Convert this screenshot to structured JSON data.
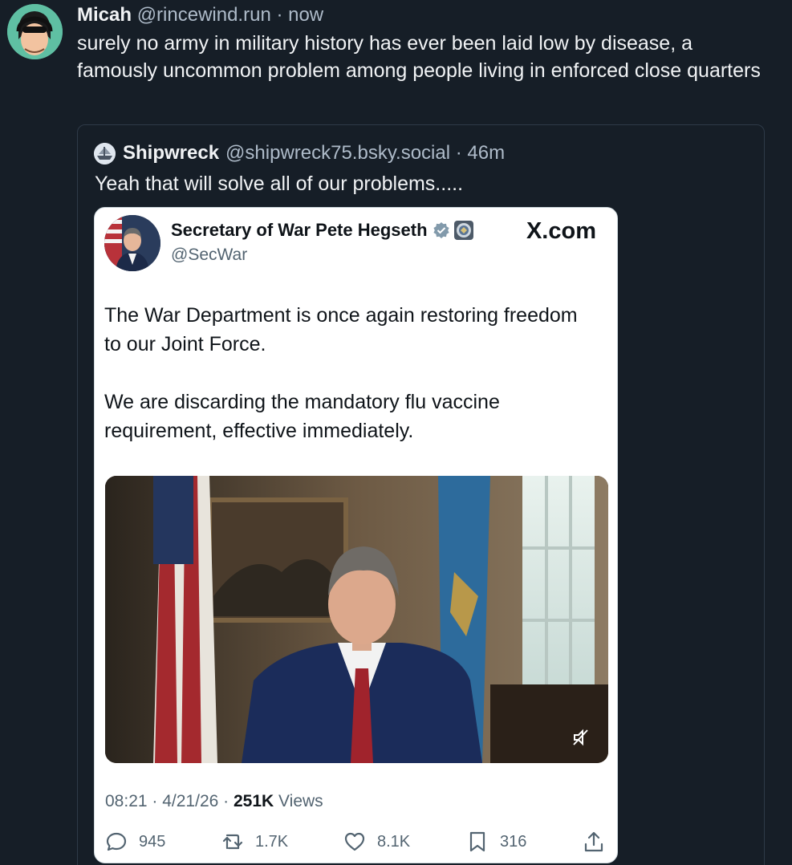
{
  "post": {
    "author_name": "Micah",
    "author_meta": "@rincewind.run · now",
    "text": "surely no army in military history has ever been laid low by disease, a famously uncommon problem among people living in enforced close quarters"
  },
  "quote": {
    "author_name": "Shipwreck",
    "author_meta": "@shipwreck75.bsky.social · 46m",
    "text": "Yeah that will solve all of our problems....."
  },
  "embed": {
    "author_name": "Secretary of War Pete Hegseth",
    "handle": "@SecWar",
    "brand": "X.com",
    "body": [
      "The War Department is once again restoring freedom to our Joint Force.",
      "We are discarding the mandatory flu vaccine requirement, effective immediately."
    ],
    "time": "08:21",
    "date": "4/21/26",
    "views_count": "251K",
    "views_label": "Views",
    "replies": "945",
    "reposts": "1.7K",
    "likes": "8.1K",
    "bookmarks": "316"
  },
  "colors": {
    "background": "#161e27",
    "muted_text": "#aebbc9",
    "verified_badge": "#829aab"
  }
}
